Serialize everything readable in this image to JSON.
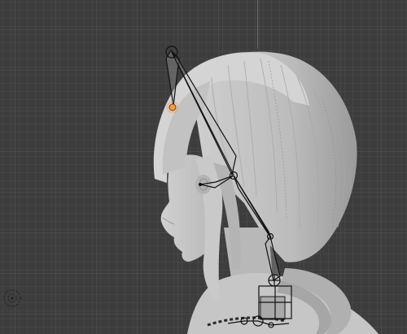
{
  "viewport": {
    "mode": "pose-edit",
    "axis_color": "#4a66d6",
    "background_color": "#3d3d3d",
    "model_color": "#bfbfbf",
    "selected_bone_color": "#ff9a3c"
  },
  "icons": {
    "navigation": "orbit-gizmo-icon"
  }
}
